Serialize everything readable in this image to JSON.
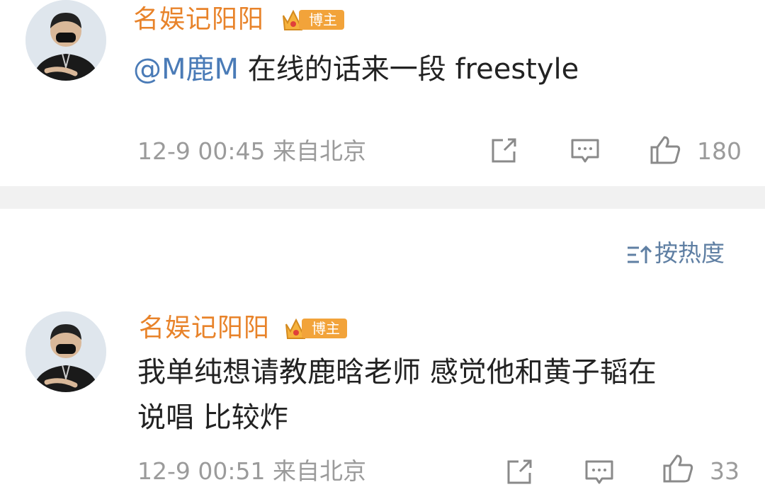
{
  "comments": [
    {
      "author": "名娱记阳阳",
      "badge": "博主",
      "mention": "@M鹿M",
      "text": "在线的话来一段 freestyle",
      "timestamp": "12-9 00:45",
      "location": "来自北京",
      "likes": "180"
    },
    {
      "author": "名娱记阳阳",
      "badge": "博主",
      "text_line1": "我单纯想请教鹿晗老师 感觉他和黄子韬在",
      "text_line2": "说唱 比较炸",
      "timestamp": "12-9 00:51",
      "location": "来自北京",
      "likes": "33"
    }
  ],
  "sort": {
    "label": "按热度"
  },
  "icons": [
    "avatar",
    "crown-icon",
    "share-icon",
    "comment-icon",
    "like-icon",
    "sort-icon"
  ],
  "colors": {
    "author": "#e8832a",
    "mention": "#4a7bb7",
    "meta": "#9b9b9b",
    "badge": "#f2a33a",
    "sort": "#5f7fa3"
  }
}
